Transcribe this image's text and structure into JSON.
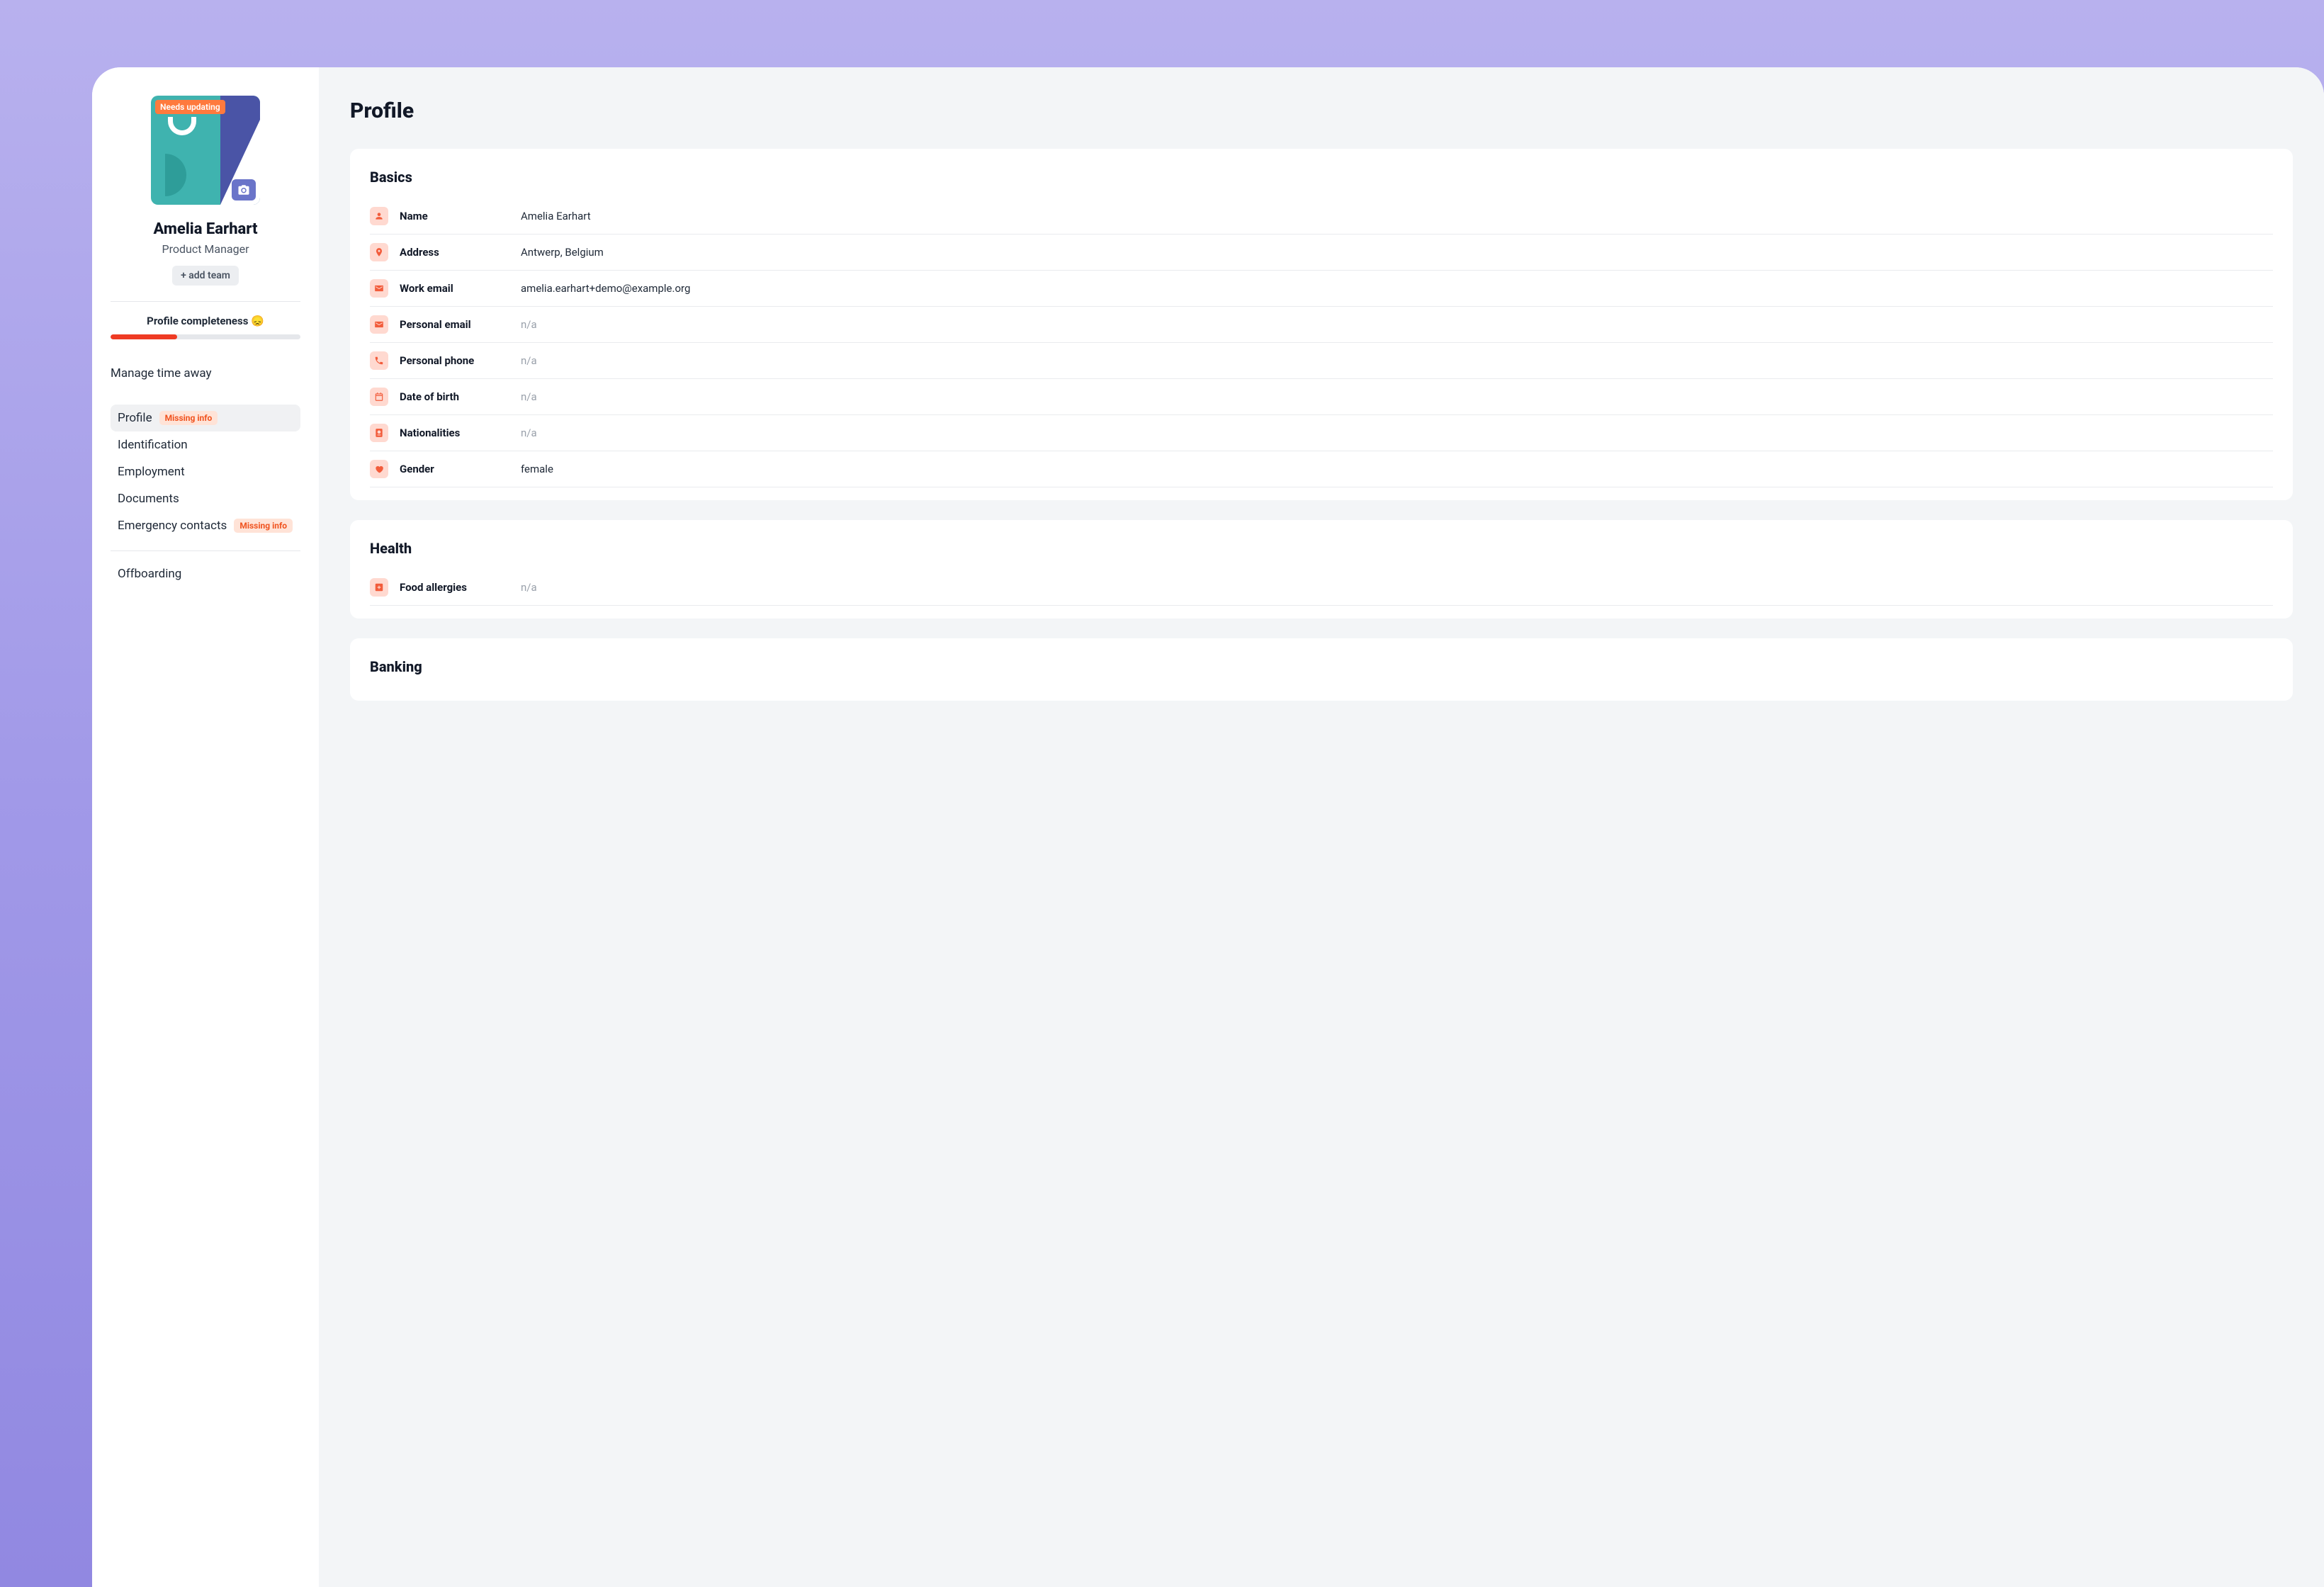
{
  "sidebar": {
    "avatar_badge": "Needs updating",
    "user_name": "Amelia Earhart",
    "user_title": "Product Manager",
    "add_team_label": "+ add team",
    "completeness_label": "Profile completeness 😞",
    "completeness_percent": 35,
    "manage_time_away": "Manage time away",
    "missing_info_pill": "Missing info",
    "nav": {
      "profile": "Profile",
      "identification": "Identification",
      "employment": "Employment",
      "documents": "Documents",
      "emergency_contacts": "Emergency contacts",
      "offboarding": "Offboarding"
    }
  },
  "main": {
    "page_title": "Profile",
    "na": "n/a",
    "sections": {
      "basics": {
        "heading": "Basics",
        "fields": {
          "name": {
            "label": "Name",
            "value": "Amelia Earhart"
          },
          "address": {
            "label": "Address",
            "value": "Antwerp, Belgium"
          },
          "work_email": {
            "label": "Work email",
            "value": "amelia.earhart+demo@example.org"
          },
          "personal_email": {
            "label": "Personal email",
            "value": null
          },
          "personal_phone": {
            "label": "Personal phone",
            "value": null
          },
          "dob": {
            "label": "Date of birth",
            "value": null
          },
          "nationalities": {
            "label": "Nationalities",
            "value": null
          },
          "gender": {
            "label": "Gender",
            "value": "female"
          }
        }
      },
      "health": {
        "heading": "Health",
        "fields": {
          "food_allergies": {
            "label": "Food allergies",
            "value": null
          }
        }
      },
      "banking": {
        "heading": "Banking"
      }
    }
  }
}
